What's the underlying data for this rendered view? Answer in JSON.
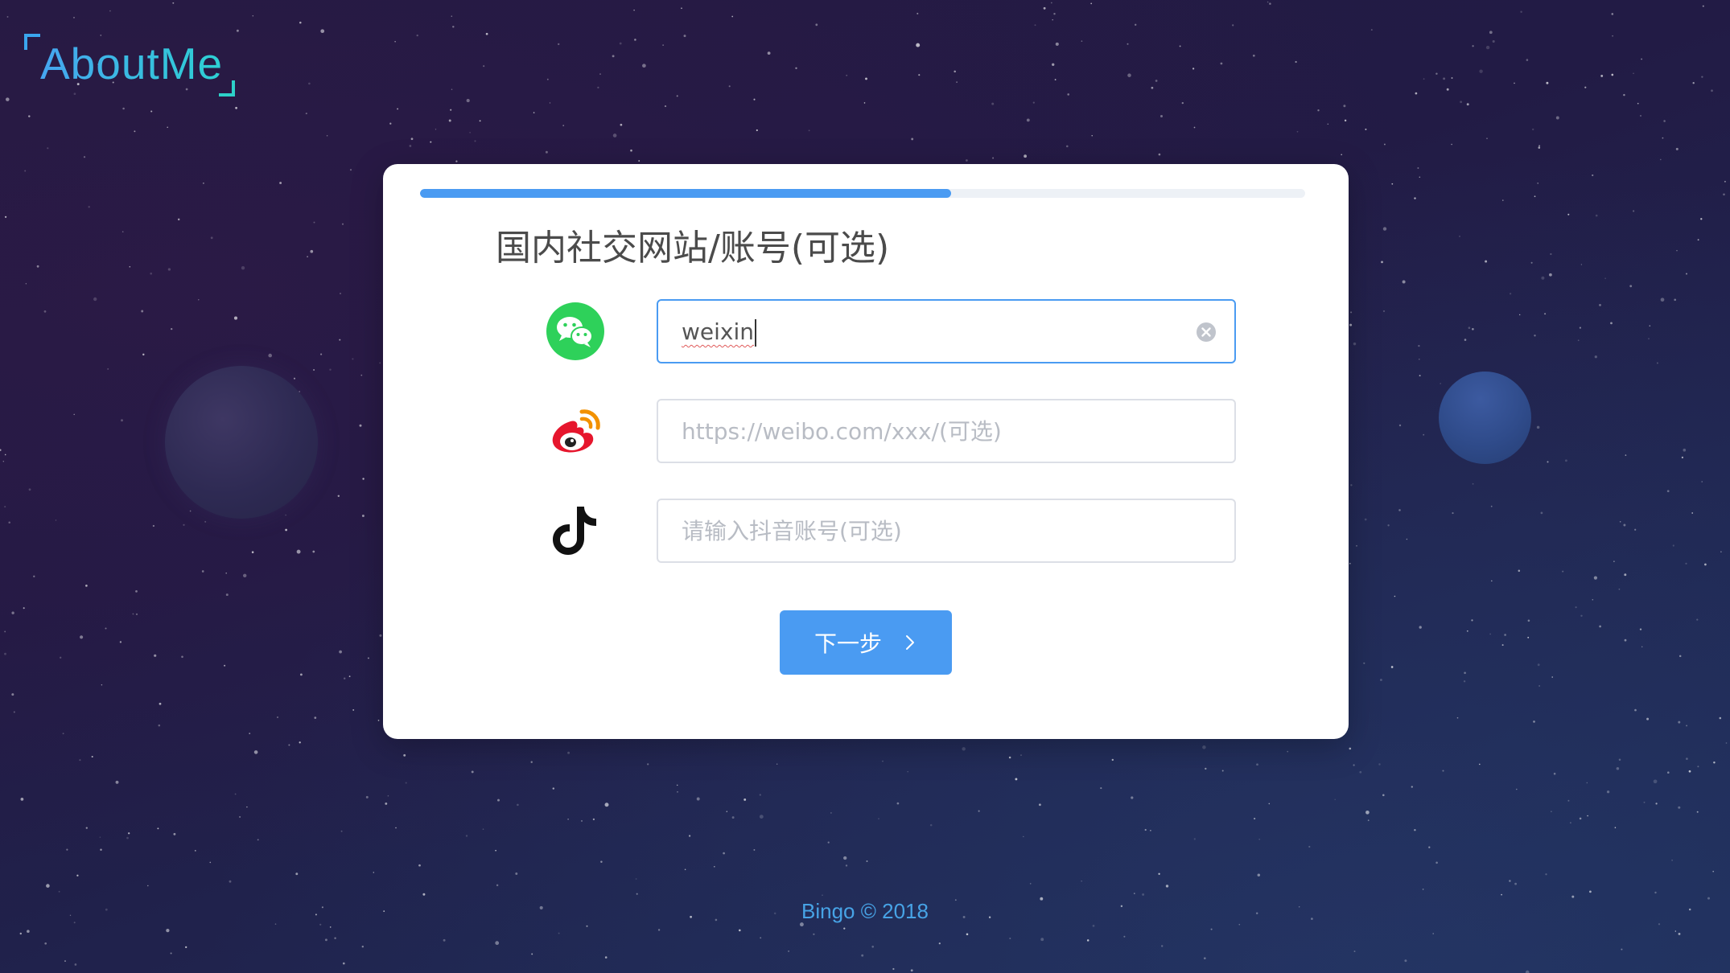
{
  "brand": {
    "logo_text": "AboutMe"
  },
  "colors": {
    "accent": "#4a9bf2",
    "logo_gradient_start": "#46a5f0",
    "logo_gradient_end": "#2dd1d3",
    "wechat": "#2ed15a",
    "weibo": "#e6162d",
    "footer_text": "#47a3e6"
  },
  "progress": {
    "fraction": 0.6
  },
  "form": {
    "title": "国内社交网站/账号(可选)",
    "fields": [
      {
        "icon": "wechat-icon",
        "value": "weixin",
        "placeholder": "",
        "focused": true
      },
      {
        "icon": "weibo-icon",
        "value": "",
        "placeholder": "https://weibo.com/xxx/(可选)"
      },
      {
        "icon": "tiktok-icon",
        "value": "",
        "placeholder": "请输入抖音账号(可选)"
      }
    ],
    "next_label": "下一步"
  },
  "footer": {
    "text": "Bingo © 2018"
  }
}
